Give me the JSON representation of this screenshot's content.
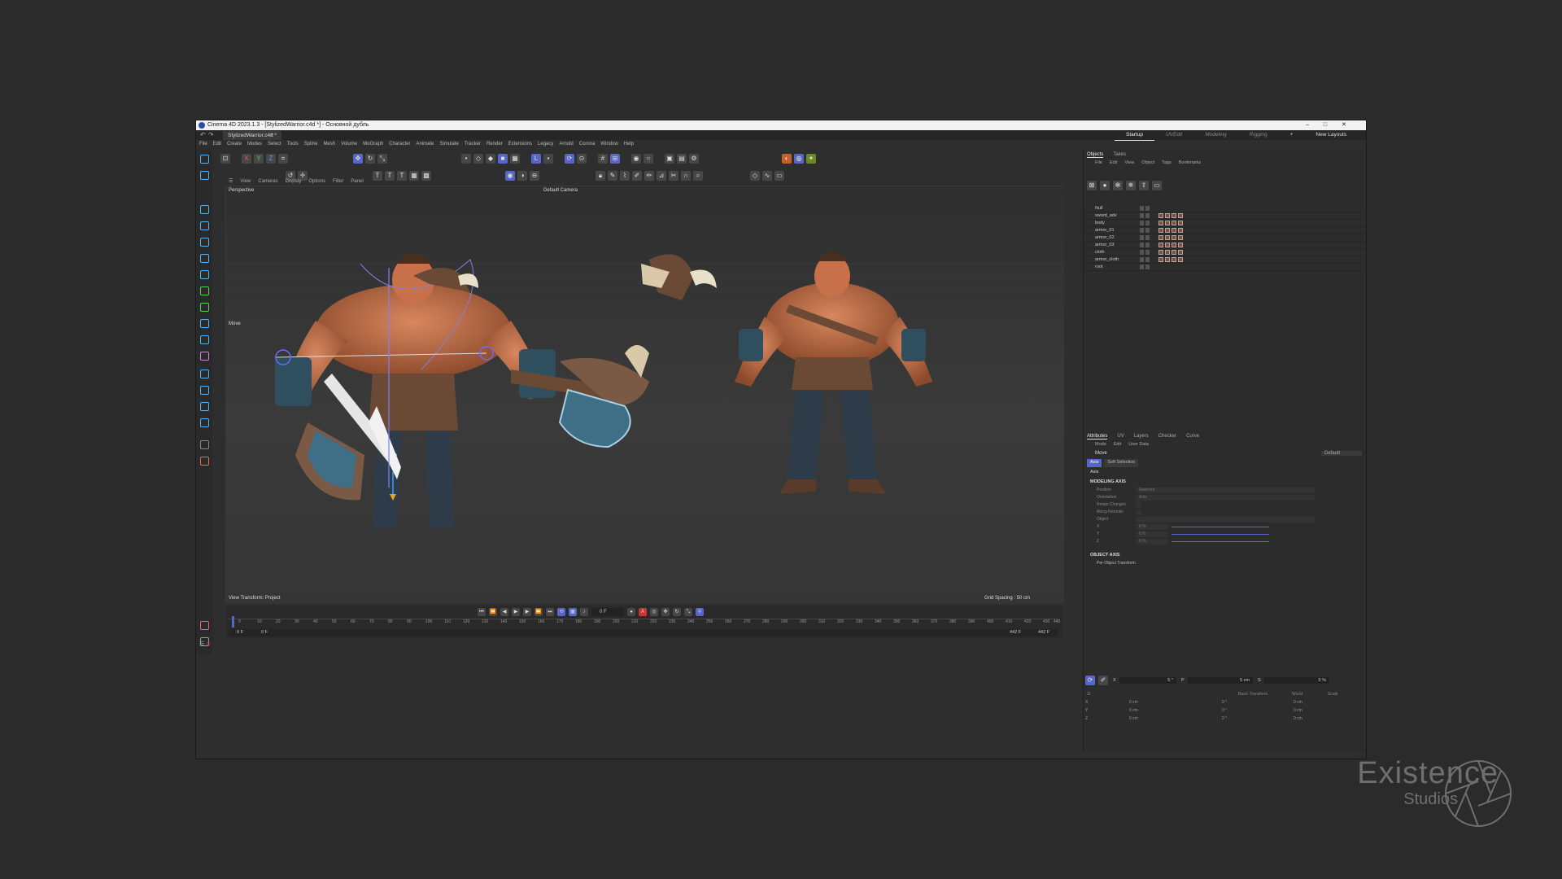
{
  "window": {
    "title": "Cinema 4D 2023.1.3 - [StylizedWarrior.c4d *] - Основной дубль",
    "doc_tab": "StylizedWarrior.c4d *",
    "new_tab": "+"
  },
  "layouts": [
    "Startup",
    "UVEdit",
    "Modeling",
    "Rigging"
  ],
  "new_layouts": "New Layouts",
  "menu": [
    "File",
    "Edit",
    "Create",
    "Modes",
    "Select",
    "Tools",
    "Spline",
    "Mesh",
    "Volume",
    "MoGraph",
    "Character",
    "Animate",
    "Simulate",
    "Tracker",
    "Render",
    "Extensions",
    "Legacy",
    "Arnold",
    "Corona",
    "Window",
    "Help"
  ],
  "coord_axes": [
    "X",
    "Y",
    "Z"
  ],
  "viewport": {
    "menu": [
      "View",
      "Cameras",
      "Display",
      "Options",
      "Filter",
      "Panel"
    ],
    "name": "Perspective",
    "camera": "Default Camera",
    "tool": "Move",
    "view_transform": "View Transform: Project",
    "grid_spacing": "Grid Spacing : 50 cm"
  },
  "timeline": {
    "current_frame": "0 F",
    "ticks": [
      "0",
      "10",
      "20",
      "30",
      "40",
      "50",
      "60",
      "70",
      "80",
      "90",
      "100",
      "110",
      "120",
      "130",
      "140",
      "150",
      "160",
      "170",
      "180",
      "190",
      "200",
      "210",
      "220",
      "230",
      "240",
      "250",
      "260",
      "270",
      "280",
      "290",
      "300",
      "310",
      "320",
      "330",
      "340",
      "350",
      "360",
      "370",
      "380",
      "390",
      "400",
      "410",
      "420",
      "430",
      "440"
    ],
    "start": "0 F",
    "preview_start": "0 F",
    "end": "442 F",
    "end2": "442 F"
  },
  "objects_panel": {
    "tabs": [
      "Objects",
      "Takes"
    ],
    "menu": [
      "File",
      "Edit",
      "View",
      "Object",
      "Tags",
      "Bookmarks"
    ],
    "items": [
      "Null",
      "sword_adv",
      "body",
      "armor_01",
      "armor_02",
      "armor_03",
      "cloth",
      "armor_cloth",
      "root"
    ]
  },
  "attributes_panel": {
    "tabs": [
      "Attributes",
      "UV",
      "Layers",
      "Checker",
      "Curve"
    ],
    "menu": [
      "Mode",
      "Edit",
      "User Data"
    ],
    "tool_name": "Move",
    "preset": "Default",
    "subtabs": [
      "Axis",
      "Soft Selection"
    ],
    "section_label": "Axis",
    "modeling_axis": "MODELING AXIS",
    "props": [
      {
        "label": "Position",
        "value": "Selected"
      },
      {
        "label": "Orientation",
        "value": "Axis"
      },
      {
        "label": "Retain Changes",
        "value": ""
      },
      {
        "label": "Along Normals",
        "value": ""
      },
      {
        "label": "Object",
        "value": ""
      },
      {
        "label": "X",
        "value": "0 %"
      },
      {
        "label": "Y",
        "value": "0 %"
      },
      {
        "label": "Z",
        "value": "0 %"
      }
    ],
    "object_axis": "OBJECT AXIS",
    "per_object": "Per-Object Transform"
  },
  "coords_panel": {
    "snap_x": "5 °",
    "snap_p": "5 cm",
    "snap_s": "5 %",
    "labels": [
      "X",
      "P",
      "S"
    ],
    "mode_a": "Basic Transform",
    "mode_b": "World",
    "mode_c": "Scale",
    "rows": [
      {
        "axis": "X",
        "p": "0 cm",
        "r": "0 °",
        "s": "0 cm"
      },
      {
        "axis": "Y",
        "p": "0 cm",
        "r": "0 °",
        "s": "0 cm"
      },
      {
        "axis": "Z",
        "p": "0 cm",
        "r": "0 °",
        "s": "0 cm"
      }
    ]
  },
  "watermark": {
    "line1": "Existence",
    "line2": "Studios"
  }
}
